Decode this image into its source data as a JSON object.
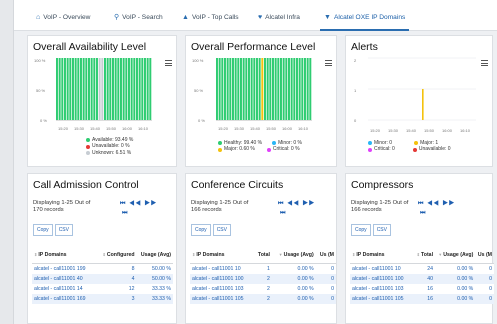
{
  "tabs": [
    {
      "label": "VoIP - Overview",
      "icon": "home-icon"
    },
    {
      "label": "VoIP - Search",
      "icon": "search-icon"
    },
    {
      "label": "VoIP - Top Calls",
      "icon": "arrow-up-icon"
    },
    {
      "label": "Alcatel Infra",
      "icon": "heart-icon"
    },
    {
      "label": "Alcatel OXE IP Domains",
      "icon": "filter-icon"
    }
  ],
  "panels": {
    "availability": {
      "title": "Overall Availability Level",
      "y_ticks": [
        "100 %",
        "50 %",
        "0 %"
      ],
      "x_ticks": [
        "15:20",
        "15:30",
        "15:40",
        "15:50",
        "16:00",
        "16:10"
      ],
      "legend": [
        {
          "label": "Available: 93.49 %",
          "color": "#2ecc71"
        },
        {
          "label": "Unavailable: 0 %",
          "color": "#e53935"
        },
        {
          "label": "Unknown: 6.51 %",
          "color": "#c7cdd3"
        }
      ]
    },
    "performance": {
      "title": "Overall Performance Level",
      "y_ticks": [
        "100 %",
        "50 %",
        "0 %"
      ],
      "x_ticks": [
        "15:20",
        "15:30",
        "15:40",
        "15:50",
        "16:00",
        "16:10"
      ],
      "legend": [
        {
          "label": "Healthy: 99.40 %",
          "color": "#2ecc71"
        },
        {
          "label": "Minor: 0 %",
          "color": "#29b6f6"
        },
        {
          "label": "Major: 0.60 %",
          "color": "#f4c20d"
        },
        {
          "label": "Critical: 0 %",
          "color": "#e040fb"
        }
      ]
    },
    "alerts": {
      "title": "Alerts",
      "y_ticks": [
        "2",
        "1",
        "0"
      ],
      "x_ticks": [
        "15:20",
        "15:30",
        "15:40",
        "15:50",
        "16:00",
        "16:10"
      ],
      "legend": [
        {
          "label": "Minor: 0",
          "color": "#29b6f6"
        },
        {
          "label": "Major: 1",
          "color": "#f4c20d"
        },
        {
          "label": "Critical: 0",
          "color": "#e040fb"
        },
        {
          "label": "Unavailable: 0",
          "color": "#e53935"
        }
      ]
    },
    "cac": {
      "title": "Call Admission Control",
      "info": "Displaying 1-25 Out of 170 records",
      "pager_a": "⏮ ◀◀ ▶▶",
      "pager_b": "⏭",
      "copy": "Copy",
      "csv": "CSV",
      "columns": [
        "IP Domains",
        "Configured",
        "Usage (Avg)"
      ],
      "rows": [
        [
          "alcatel - call11001 199",
          "8",
          "50.00 %"
        ],
        [
          "alcatel - call11001 40",
          "4",
          "50.00 %"
        ],
        [
          "alcatel - call11001 14",
          "12",
          "33.33 %"
        ],
        [
          "alcatel - call11001 169",
          "3",
          "33.33 %"
        ]
      ]
    },
    "conference": {
      "title": "Conference Circuits",
      "info": "Displaying 1-25 Out of 166 records",
      "pager_a": "⏮ ◀◀ ▶▶",
      "pager_b": "⏭",
      "copy": "Copy",
      "csv": "CSV",
      "columns": [
        "IP Domains",
        "Total",
        "Usage (Avg)",
        "Us (M"
      ],
      "rows": [
        [
          "alcatel - call11001 10",
          "1",
          "0.00 %",
          "0"
        ],
        [
          "alcatel - call11001 100",
          "2",
          "0.00 %",
          "0"
        ],
        [
          "alcatel - call11001 103",
          "2",
          "0.00 %",
          "0"
        ],
        [
          "alcatel - call11001 105",
          "2",
          "0.00 %",
          "0"
        ]
      ]
    },
    "compressors": {
      "title": "Compressors",
      "info": "Displaying 1-25 Out of 166 records",
      "pager_a": "⏮ ◀◀ ▶▶",
      "pager_b": "⏭",
      "copy": "Copy",
      "csv": "CSV",
      "columns": [
        "IP Domains",
        "Total",
        "Usage (Avg)",
        "Us (M"
      ],
      "rows": [
        [
          "alcatel - call11001 10",
          "24",
          "0.00 %",
          "0"
        ],
        [
          "alcatel - call11001 100",
          "40",
          "0.00 %",
          "0"
        ],
        [
          "alcatel - call11001 103",
          "16",
          "0.00 %",
          "0"
        ],
        [
          "alcatel - call11001 105",
          "16",
          "0.00 %",
          "0"
        ]
      ]
    }
  },
  "chart_data": [
    {
      "type": "bar",
      "title": "Overall Availability Level",
      "ylim": [
        0,
        100
      ],
      "x_ticks": [
        "15:20",
        "15:30",
        "15:40",
        "15:50",
        "16:00",
        "16:10"
      ],
      "series": [
        {
          "name": "Available",
          "total": 93.49,
          "color": "#2ecc71"
        },
        {
          "name": "Unavailable",
          "total": 0,
          "color": "#e53935"
        },
        {
          "name": "Unknown",
          "total": 6.51,
          "color": "#c7cdd3"
        }
      ]
    },
    {
      "type": "bar",
      "title": "Overall Performance Level",
      "ylim": [
        0,
        100
      ],
      "x_ticks": [
        "15:20",
        "15:30",
        "15:40",
        "15:50",
        "16:00",
        "16:10"
      ],
      "series": [
        {
          "name": "Healthy",
          "total": 99.4,
          "color": "#2ecc71"
        },
        {
          "name": "Minor",
          "total": 0,
          "color": "#29b6f6"
        },
        {
          "name": "Major",
          "total": 0.6,
          "color": "#f4c20d"
        },
        {
          "name": "Critical",
          "total": 0,
          "color": "#e040fb"
        }
      ]
    },
    {
      "type": "bar",
      "title": "Alerts",
      "ylim": [
        0,
        2
      ],
      "x_ticks": [
        "15:20",
        "15:30",
        "15:40",
        "15:50",
        "16:00",
        "16:10"
      ],
      "series": [
        {
          "name": "Minor",
          "total": 0,
          "color": "#29b6f6"
        },
        {
          "name": "Major",
          "total": 1,
          "color": "#f4c20d"
        },
        {
          "name": "Critical",
          "total": 0,
          "color": "#e040fb"
        },
        {
          "name": "Unavailable",
          "total": 0,
          "color": "#e53935"
        }
      ]
    }
  ]
}
